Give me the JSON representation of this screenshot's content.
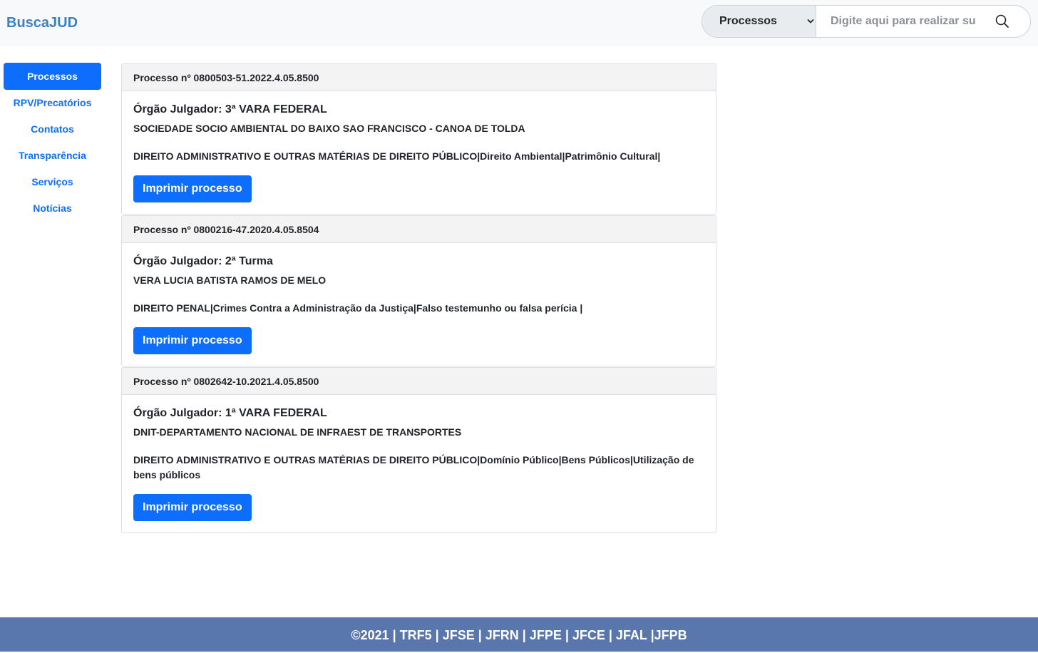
{
  "header": {
    "brand": "BuscaJUD",
    "search": {
      "selected": "Processos",
      "placeholder": "Digite aqui para realizar sua busca",
      "icons": {
        "dropdown": "chevron-down-icon",
        "submit": "search-icon"
      }
    }
  },
  "sidebar": {
    "items": [
      {
        "label": "Processos",
        "active": true
      },
      {
        "label": "RPV/Precatórios",
        "active": false
      },
      {
        "label": "Contatos",
        "active": false
      },
      {
        "label": "Transparência",
        "active": false
      },
      {
        "label": "Serviços",
        "active": false
      },
      {
        "label": "Notícias",
        "active": false
      }
    ]
  },
  "results": [
    {
      "header": "Processo nº 0800503-51.2022.4.05.8500",
      "orgao": "Órgão Julgador: 3ª VARA FEDERAL",
      "parte": "SOCIEDADE SOCIO AMBIENTAL DO BAIXO SAO FRANCISCO - CANOA DE TOLDA",
      "assunto": "DIREITO ADMINISTRATIVO E OUTRAS MATÉRIAS DE DIREITO PÚBLICO|Direito Ambiental|Patrimônio Cultural|",
      "button": "Imprimir processo"
    },
    {
      "header": "Processo nº 0800216-47.2020.4.05.8504",
      "orgao": "Órgão Julgador: 2ª Turma",
      "parte": "VERA LUCIA BATISTA RAMOS DE MELO",
      "assunto": "DIREITO PENAL|Crimes Contra a Administração da Justiça|Falso testemunho ou falsa perícia |",
      "button": "Imprimir processo"
    },
    {
      "header": "Processo nº 0802642-10.2021.4.05.8500",
      "orgao": "Órgão Julgador: 1ª VARA FEDERAL",
      "parte": "DNIT-DEPARTAMENTO NACIONAL DE INFRAEST DE TRANSPORTES",
      "assunto": "DIREITO ADMINISTRATIVO E OUTRAS MATÉRIAS DE DIREITO PÚBLICO|Domínio Público|Bens Públicos|Utilização de bens públicos",
      "button": "Imprimir processo"
    }
  ],
  "footer": {
    "text": "©2021 | TRF5 | JFSE | JFRN | JFPE | JFCE | JFAL |JFPB"
  },
  "colors": {
    "primary": "#0d6efd",
    "brand": "#3b82c4",
    "footer": "#5a77ad",
    "header_bg": "#f8f9fa",
    "card_header_bg": "#f3f3f3"
  }
}
